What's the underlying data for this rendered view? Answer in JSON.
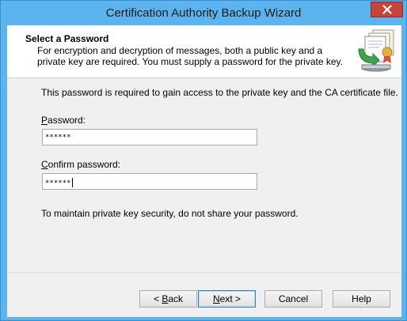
{
  "window": {
    "title": "Certification Authority Backup Wizard",
    "close_glyph": "✕"
  },
  "header": {
    "title": "Select a Password",
    "description": "For encryption and decryption of messages, both a public key and a private key are required. You must supply a password for the private key.",
    "icon": "certificate-backup-icon"
  },
  "body": {
    "intro": "This password is required to gain access to the private key and the CA certificate file.",
    "password": {
      "label_access": "P",
      "label_rest": "assword:",
      "value": "******"
    },
    "confirm_password": {
      "label_access": "C",
      "label_rest": "onfirm password:",
      "value": "******"
    },
    "note": "To maintain private key security, do not share your password."
  },
  "buttons": {
    "back": {
      "prefix": "< ",
      "access": "B",
      "rest": "ack"
    },
    "next": {
      "access": "N",
      "rest": "ext >"
    },
    "cancel": "Cancel",
    "help": "Help"
  }
}
